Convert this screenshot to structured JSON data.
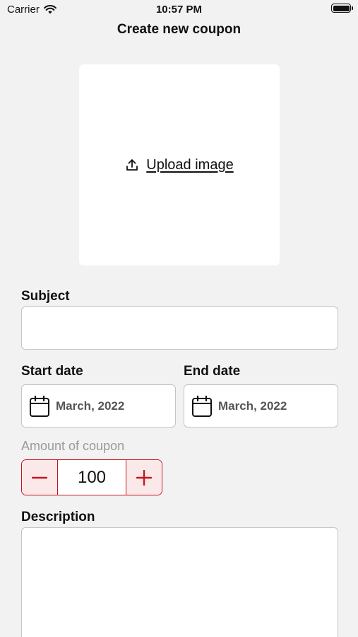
{
  "status_bar": {
    "carrier": "Carrier",
    "time": "10:57 PM"
  },
  "nav": {
    "title": "Create new coupon"
  },
  "upload": {
    "label": "Upload image"
  },
  "subject": {
    "label": "Subject",
    "value": ""
  },
  "start_date": {
    "label": "Start date",
    "value": "March, 2022"
  },
  "end_date": {
    "label": "End date",
    "value": "March, 2022"
  },
  "amount": {
    "label": "Amount of coupon",
    "value": "100"
  },
  "description": {
    "label": "Description",
    "value": ""
  },
  "colors": {
    "accent": "#c8141e",
    "background": "#f2f2f2",
    "field_border": "#c4c4c4"
  }
}
